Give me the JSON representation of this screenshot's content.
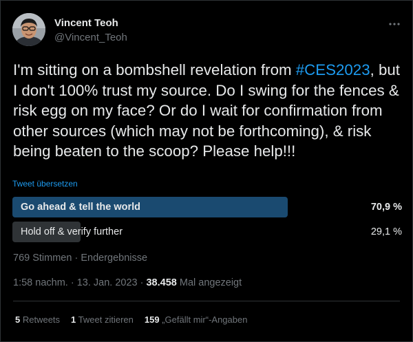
{
  "author": {
    "name": "Vincent Teoh",
    "handle": "@Vincent_Teoh"
  },
  "tweet": {
    "text_before": "I'm sitting on a bombshell revelation from ",
    "hashtag": "#CES2023",
    "text_after": ", but I don't 100% trust my source. Do I swing for the fences & risk egg on my face? Or do I wait for confirmation from other sources (which may not be forthcoming), & risk being beaten to the scoop? Please help!!!",
    "translate_label": "Tweet übersetzen"
  },
  "poll": {
    "options": [
      {
        "label": "Go ahead & tell the world",
        "percent": "70,9 %",
        "share": 70.9
      },
      {
        "label": "Hold off & verify further",
        "percent": "29,1 %",
        "share": 29.1
      }
    ],
    "votes": "769 Stimmen",
    "separator": " · ",
    "status": "Endergebnisse"
  },
  "meta": {
    "time": "1:58 nachm.",
    "date": "13. Jan. 2023",
    "separator": " · ",
    "views_count": "38.458",
    "views_label": " Mal angezeigt"
  },
  "stats": {
    "retweets_count": "5",
    "retweets_label": " Retweets",
    "quotes_count": "1",
    "quotes_label": " Tweet zitieren",
    "likes_count": "159",
    "likes_label": " „Gefällt mir“-Angaben"
  },
  "colors": {
    "accent": "#1d9bf0",
    "poll_winner": "#1a4a70",
    "poll_loser": "#2f3336",
    "background": "#000000"
  },
  "icons": {
    "more": "more-horizontal-icon",
    "avatar": "avatar-photo"
  }
}
